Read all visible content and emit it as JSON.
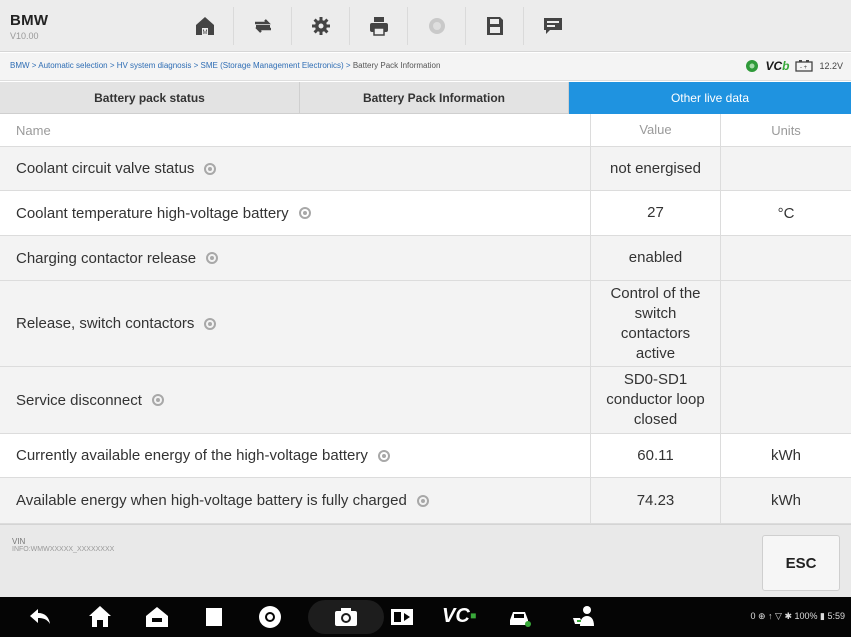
{
  "app": {
    "brand": "BMW",
    "version": "V10.00"
  },
  "toolbar": {
    "buttons": [
      {
        "icon": "home-icon"
      },
      {
        "icon": "vehicle-swap-icon"
      },
      {
        "icon": "gear-icon"
      },
      {
        "icon": "print-icon"
      },
      {
        "icon": "help-icon",
        "disabled": true
      },
      {
        "icon": "save-icon"
      },
      {
        "icon": "data-logging-icon"
      }
    ]
  },
  "breadcrumb": {
    "path": "BMW > Automatic selection > HV system diagnosis > SME (Storage Management Electronics) > ",
    "current": "Battery Pack Information"
  },
  "status": {
    "vci": "VC",
    "vci_b": "b",
    "voltage": "12.2V"
  },
  "tabs": [
    {
      "label": "Battery pack status",
      "active": false
    },
    {
      "label": "Battery Pack Information",
      "active": false
    },
    {
      "label": "Other live data",
      "active": true
    }
  ],
  "table": {
    "headers": {
      "name": "Name",
      "value": "Value",
      "units": "Units"
    },
    "rows": [
      {
        "name": "Coolant circuit valve status",
        "value": "not energised",
        "unit": ""
      },
      {
        "name": "Coolant temperature high-voltage battery",
        "value": "27",
        "unit": "°C"
      },
      {
        "name": "Charging contactor release",
        "value": "enabled",
        "unit": ""
      },
      {
        "name": "Release, switch contactors",
        "value": "Control of the switch contactors active",
        "unit": ""
      },
      {
        "name": "Service disconnect",
        "value": "SD0-SD1 conductor loop closed",
        "unit": ""
      },
      {
        "name": "Currently available energy of the high-voltage battery",
        "value": "60.11",
        "unit": "kWh"
      },
      {
        "name": "Available energy when high-voltage battery is fully charged",
        "value": "74.23",
        "unit": "kWh"
      }
    ]
  },
  "footer": {
    "vin_label": "VIN",
    "vin_value": "INFO:WMWXXXXX_XXXXXXXX",
    "esc_label": "ESC"
  },
  "navbar": {
    "vci_label": "VC",
    "system_status": "0 ⊕ ↑ ▽ ✱ 100% ▮ 5:59"
  },
  "colors": {
    "accent": "#1f93e0",
    "vci_green": "#39a93a"
  }
}
